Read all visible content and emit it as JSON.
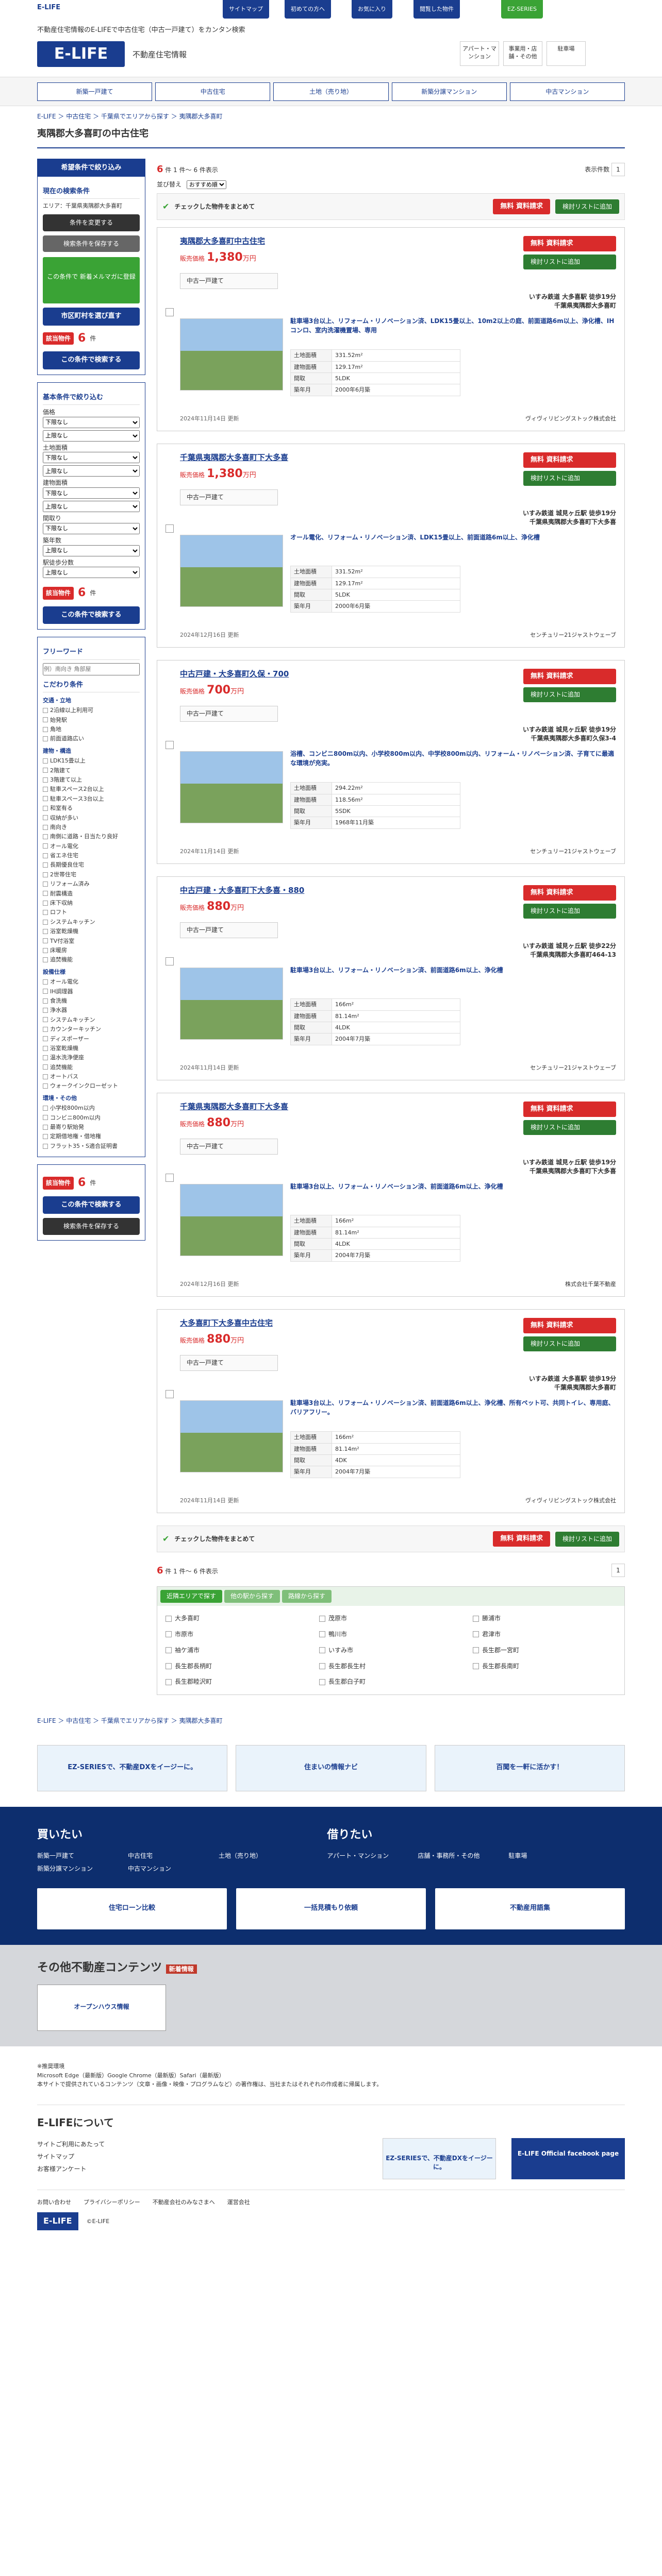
{
  "header": {
    "small_logo": "E-LIFE",
    "tagline": "不動産住宅情報のE-LIFEで中古住宅（中古一戸建て）をカンタン検索",
    "logo": "E-LIFE",
    "subtitle": "不動産住宅情報",
    "gnav": [
      "サイトマップ",
      "初めての方へ",
      "お気に入り",
      "閲覧した物件"
    ],
    "boxes": [
      "アパート・マンション",
      "事業用・店舗・その他",
      "駐車場"
    ]
  },
  "nav": [
    "新築一戸建て",
    "中古住宅",
    "土地（売り地）",
    "新築分譲マンション",
    "中古マンション"
  ],
  "breadcrumb": "E-LIFE ＞ 中古住宅 ＞ 千葉県でエリアから探す ＞ 夷隅郡大多喜町",
  "page_title": "夷隅郡大多喜町の中古住宅",
  "sidebar": {
    "head": "希望条件で絞り込み",
    "current": "現在の検索条件",
    "area_text": "エリア：千葉県夷隅郡大多喜町",
    "change": "条件を変更する",
    "save": "検索条件を保存する",
    "banner": "この条件で 新着メルマガに登録",
    "sub_btn": "市区町村を選び直す",
    "count_label": "該当物件",
    "count": "6",
    "count_unit": "件",
    "go": "この条件で検索する",
    "basic": "基本条件で絞り込む",
    "price": "価格",
    "land": "土地面積",
    "building": "建物面積",
    "layout": "間取り",
    "age": "築年数",
    "walk": "駅徒歩分数",
    "lower": "下限なし",
    "upper": "上限なし",
    "free": "フリーワード",
    "free_ph": "例）南向き 角部屋",
    "kodawari": "こだわり条件",
    "groups": [
      {
        "title": "交通・立地",
        "items": [
          "2沿線以上利用可",
          "始発駅",
          "角地",
          "前面道路広い"
        ]
      },
      {
        "title": "建物・構造",
        "items": [
          "LDK15畳以上",
          "2階建て",
          "3階建て以上",
          "駐車スペース2台以上",
          "駐車スペース3台以上",
          "和室有る",
          "収納が多い",
          "南向き",
          "南側に道路・日当たり良好",
          "オール電化",
          "省エネ住宅",
          "長期優良住宅",
          "2世帯住宅",
          "リフォーム済み",
          "耐震構造",
          "床下収納",
          "ロフト",
          "システムキッチン",
          "浴室乾燥機",
          "TV付浴室",
          "床暖房",
          "追焚機能"
        ]
      },
      {
        "title": "設備仕様",
        "items": [
          "オール電化",
          "IH調理器",
          "食洗機",
          "浄水器",
          "システムキッチン",
          "カウンターキッチン",
          "ディスポーザー",
          "浴室乾燥機",
          "温水洗浄便座",
          "追焚機能",
          "オートバス",
          "ウォークインクローゼット"
        ]
      },
      {
        "title": "環境・その他",
        "items": [
          "小学校800m以内",
          "コンビニ800m以内",
          "最寄り駅始発",
          "定期借地権・借地権",
          "フラット35・S適合証明書"
        ]
      }
    ]
  },
  "results": {
    "total": "6",
    "range": "件 1 件〜 6 件表示",
    "sort": "並び替え",
    "sort_val": "おすすめ順",
    "per_page": "表示件数",
    "page": "1",
    "select_all": "チェックした物件をまとめて",
    "req": "資料請求",
    "free": "無料",
    "fav": "検討リストに追加",
    "area_check_all": "全選択"
  },
  "listings": [
    {
      "title": "夷隅郡大多喜町中古住宅",
      "price": "1,380",
      "unit": "万円",
      "label": "販売価格",
      "type": "中古一戸建て",
      "line": "いすみ鉄道 大多喜駅 徒歩19分",
      "addr": "千葉県夷隅郡大多喜町",
      "desc": "駐車場3台以上、リフォーム・リノベーション済、LDK15畳以上、10m2以上の庭、前面道路6m以上、浄化槽、IHコンロ、室内洗濯機置場、専用",
      "land": "331.52m²",
      "bldg": "129.17m²",
      "layout": "5LDK",
      "built": "2000年6月築",
      "upd": "2024年11月14日 更新",
      "company": "ヴィヴィリビングストック株式会社"
    },
    {
      "title": "千葉県夷隅郡大多喜町下大多喜",
      "price": "1,380",
      "unit": "万円",
      "label": "販売価格",
      "type": "中古一戸建て",
      "line": "いすみ鉄道 城見ヶ丘駅 徒歩19分",
      "addr": "千葉県夷隅郡大多喜町下大多喜",
      "desc": "オール電化、リフォーム・リノベーション済、LDK15畳以上、前面道路6m以上、浄化槽",
      "land": "331.52m²",
      "bldg": "129.17m²",
      "layout": "5LDK",
      "built": "2000年6月築",
      "upd": "2024年12月16日 更新",
      "company": "センチュリー21ジャストウェーブ"
    },
    {
      "title": "中古戸建・大多喜町久保・700",
      "price": "700",
      "unit": "万円",
      "label": "販売価格",
      "type": "中古一戸建て",
      "line": "いすみ鉄道 城見ヶ丘駅 徒歩19分",
      "addr": "千葉県夷隅郡大多喜町久保3-4",
      "desc": "浴槽、コンビニ800m以内、小学校800m以内、中学校800m以内、リフォーム・リノベーション済、子育てに最適な環境が充実。",
      "land": "294.22m²",
      "bldg": "118.56m²",
      "layout": "5SDK",
      "built": "1968年11月築",
      "upd": "2024年11月14日 更新",
      "company": "センチュリー21ジャストウェーブ"
    },
    {
      "title": "中古戸建・大多喜町下大多喜・880",
      "price": "880",
      "unit": "万円",
      "label": "販売価格",
      "type": "中古一戸建て",
      "line": "いすみ鉄道 城見ヶ丘駅 徒歩22分",
      "addr": "千葉県夷隅郡大多喜町464-13",
      "desc": "駐車場3台以上、リフォーム・リノベーション済、前面道路6m以上、浄化槽",
      "land": "166m²",
      "bldg": "81.14m²",
      "layout": "4LDK",
      "built": "2004年7月築",
      "upd": "2024年11月14日 更新",
      "company": "センチュリー21ジャストウェーブ"
    },
    {
      "title": "千葉県夷隅郡大多喜町下大多喜",
      "price": "880",
      "unit": "万円",
      "label": "販売価格",
      "type": "中古一戸建て",
      "line": "いすみ鉄道 城見ヶ丘駅 徒歩19分",
      "addr": "千葉県夷隅郡大多喜町下大多喜",
      "desc": "駐車場3台以上、リフォーム・リノベーション済、前面道路6m以上、浄化槽",
      "land": "166m²",
      "bldg": "81.14m²",
      "layout": "4LDK",
      "built": "2004年7月築",
      "upd": "2024年12月16日 更新",
      "company": "株式会社千葉不動産"
    },
    {
      "title": "大多喜町下大多喜中古住宅",
      "price": "880",
      "unit": "万円",
      "label": "販売価格",
      "type": "中古一戸建て",
      "line": "いすみ鉄道 大多喜駅 徒歩19分",
      "addr": "千葉県夷隅郡大多喜町",
      "desc": "駐車場3台以上、リフォーム・リノベーション済、前面道路6m以上、浄化槽、所有ペット可、共同トイレ、専用庭、バリアフリー。",
      "land": "166m²",
      "bldg": "81.14m²",
      "layout": "4DK",
      "built": "2004年7月築",
      "upd": "2024年11月14日 更新",
      "company": "ヴィヴィリビングストック株式会社"
    }
  ],
  "area": {
    "tabs": [
      "近隣エリアで探す",
      "他の駅から探す",
      "路線から探す"
    ],
    "items": [
      "大多喜町",
      "茂原市",
      "勝浦市",
      "市原市",
      "鴨川市",
      "君津市",
      "袖ケ浦市",
      "いすみ市",
      "長生郡一宮町",
      "長生郡長柄町",
      "長生郡長生村",
      "長生郡長南町",
      "長生郡睦沢町",
      "長生郡白子町"
    ]
  },
  "ads": [
    "EZ-SERIESで、不動産DXをイージーに。",
    "住まいの情報ナビ",
    "百聞を一軒に活かす！"
  ],
  "footer": {
    "buy": "買いたい",
    "rent": "借りたい",
    "buy_links": [
      "新築一戸建て",
      "中古住宅",
      "土地（売り地）",
      "新築分譲マンション",
      "中古マンション"
    ],
    "rent_links": [
      "アパート・マンション",
      "店舗・事務所・その他",
      "駐車場"
    ],
    "banners": [
      "住宅ローン比較",
      "一括見積もり依頼",
      "不動産用語集"
    ]
  },
  "other": {
    "title": "その他不動産コンテンツ",
    "badge": "新着情報",
    "banner": "オープンハウス情報"
  },
  "notes": [
    "※推奨環境",
    "Microsoft Edge（最新版）Google Chrome（最新版）Safari（最新版）",
    "本サイトで提供されているコンテンツ（文章・画像・映像・プログラムなど）の著作権は、当社またはそれぞれの作成者に帰属します。"
  ],
  "about": {
    "title": "E-LIFEについて",
    "links": [
      "サイトご利用にあたって",
      "サイトマップ",
      "お客様アンケート"
    ],
    "fb": "E-LIFE Official facebook page"
  },
  "bottom": {
    "links": [
      "お問い合わせ",
      "プライバシーポリシー",
      "不動産会社のみなさまへ",
      "運営会社"
    ],
    "copy": "©E-LIFE"
  }
}
